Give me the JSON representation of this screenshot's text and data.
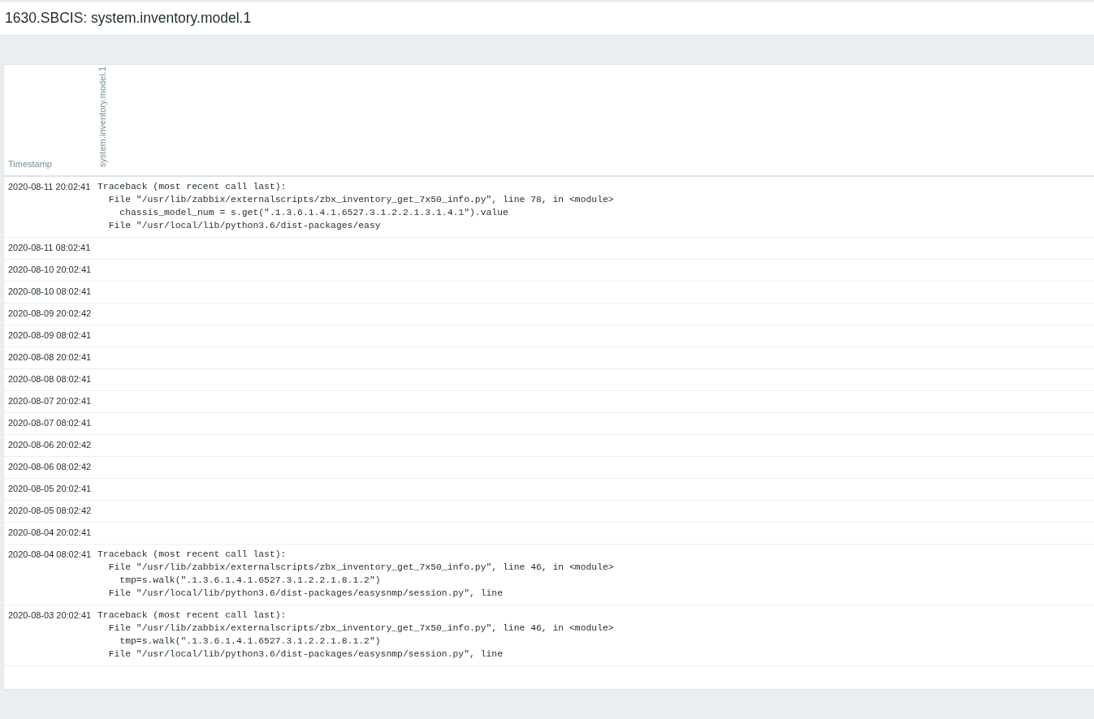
{
  "page_title": "1630.SBCIS: system.inventory.model.1",
  "table": {
    "columns": [
      "Timestamp",
      "system.inventory.model.1"
    ],
    "rows": [
      {
        "timestamp": "2020-08-11 20:02:41",
        "value": "Traceback (most recent call last):\n  File \"/usr/lib/zabbix/externalscripts/zbx_inventory_get_7x50_info.py\", line 78, in <module>\n    chassis_model_num = s.get(\".1.3.6.1.4.1.6527.3.1.2.2.1.3.1.4.1\").value\n  File \"/usr/local/lib/python3.6/dist-packages/easy"
      },
      {
        "timestamp": "2020-08-11 08:02:41"
      },
      {
        "timestamp": "2020-08-10 20:02:41"
      },
      {
        "timestamp": "2020-08-10 08:02:41"
      },
      {
        "timestamp": "2020-08-09 20:02:42"
      },
      {
        "timestamp": "2020-08-09 08:02:41"
      },
      {
        "timestamp": "2020-08-08 20:02:41"
      },
      {
        "timestamp": "2020-08-08 08:02:41"
      },
      {
        "timestamp": "2020-08-07 20:02:41"
      },
      {
        "timestamp": "2020-08-07 08:02:41"
      },
      {
        "timestamp": "2020-08-06 20:02:42"
      },
      {
        "timestamp": "2020-08-06 08:02:42"
      },
      {
        "timestamp": "2020-08-05 20:02:41"
      },
      {
        "timestamp": "2020-08-05 08:02:42"
      },
      {
        "timestamp": "2020-08-04 20:02:41"
      },
      {
        "timestamp": "2020-08-04 08:02:41",
        "value": "Traceback (most recent call last):\n  File \"/usr/lib/zabbix/externalscripts/zbx_inventory_get_7x50_info.py\", line 46, in <module>\n    tmp=s.walk(\".1.3.6.1.4.1.6527.3.1.2.2.1.8.1.2\")\n  File \"/usr/local/lib/python3.6/dist-packages/easysnmp/session.py\", line"
      },
      {
        "timestamp": "2020-08-03 20:02:41",
        "value": "Traceback (most recent call last):\n  File \"/usr/lib/zabbix/externalscripts/zbx_inventory_get_7x50_info.py\", line 46, in <module>\n    tmp=s.walk(\".1.3.6.1.4.1.6527.3.1.2.2.1.8.1.2\")\n  File \"/usr/local/lib/python3.6/dist-packages/easysnmp/session.py\", line"
      }
    ]
  }
}
